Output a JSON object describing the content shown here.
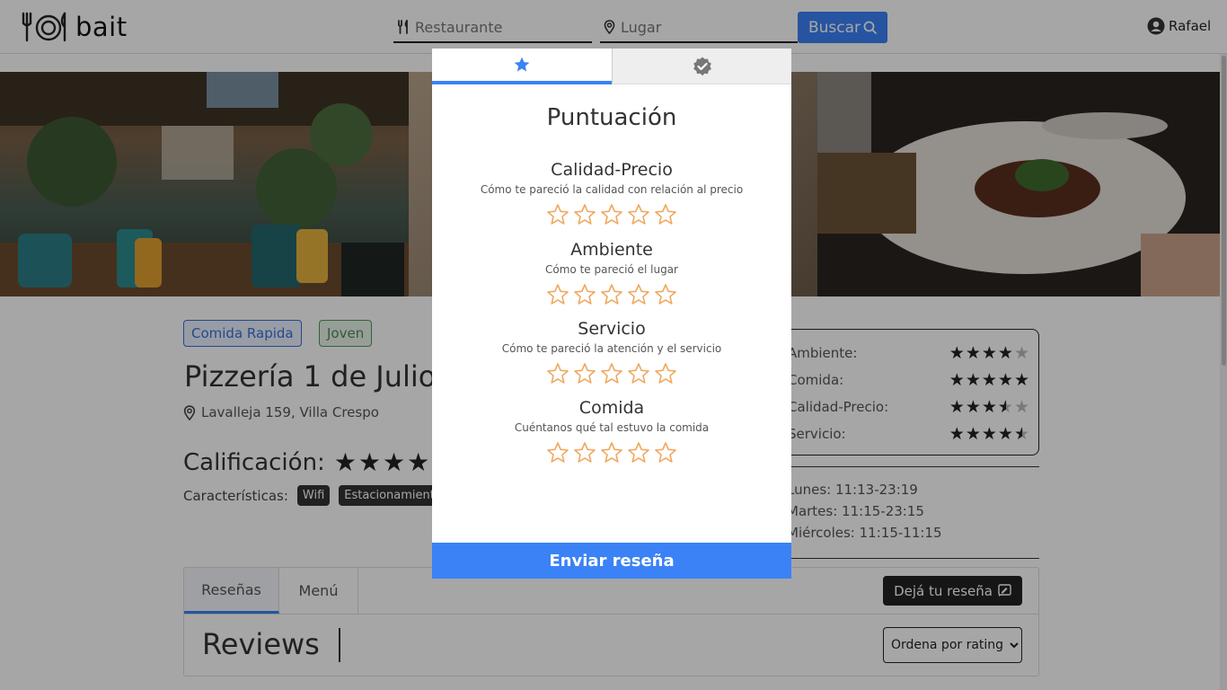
{
  "navbar": {
    "logo_text": "bait",
    "restaurant_placeholder": "Restaurante",
    "place_placeholder": "Lugar",
    "search_label": "Buscar",
    "user_name": "Rafael"
  },
  "restaurant": {
    "tags": [
      "Comida Rapida",
      "Joven"
    ],
    "name": "Pizzería 1 de Julio",
    "address": "Lavalleja 159, Villa Crespo",
    "rating_label": "Calificación:",
    "rating_stars": "★★★★",
    "features_label": "Características:",
    "features": [
      "Wifi",
      "Estacionamiento"
    ]
  },
  "ratings": [
    {
      "label": "Ambiente:",
      "value": 4
    },
    {
      "label": "Comida:",
      "value": 5
    },
    {
      "label": "Calidad-Precio:",
      "value": 3.5
    },
    {
      "label": "Servicio:",
      "value": 4.5
    }
  ],
  "hours": [
    "Lunes: 11:13-23:19",
    "Martes: 11:15-23:15",
    "Miércoles: 11:15-11:15"
  ],
  "tabs": {
    "items": [
      "Reseñas",
      "Menú"
    ],
    "review_button": "Dejá tu reseña",
    "reviews_title": "Reviews",
    "sort_selected": "Ordena por rating"
  },
  "modal": {
    "title": "Puntuación",
    "categories": [
      {
        "title": "Calidad-Precio",
        "subtitle": "Cómo te pareció la calidad con relación al precio",
        "value": 0
      },
      {
        "title": "Ambiente",
        "subtitle": "Cómo te pareció el lugar",
        "value": 0
      },
      {
        "title": "Servicio",
        "subtitle": "Cómo te pareció la atención y el servicio",
        "value": 0
      },
      {
        "title": "Comida",
        "subtitle": "Cuéntanos qué tal estuvo la comida",
        "value": 0
      }
    ],
    "submit_label": "Enviar reseña"
  },
  "colors": {
    "accent": "#3b82f6",
    "star_outline": "#f0a860"
  }
}
